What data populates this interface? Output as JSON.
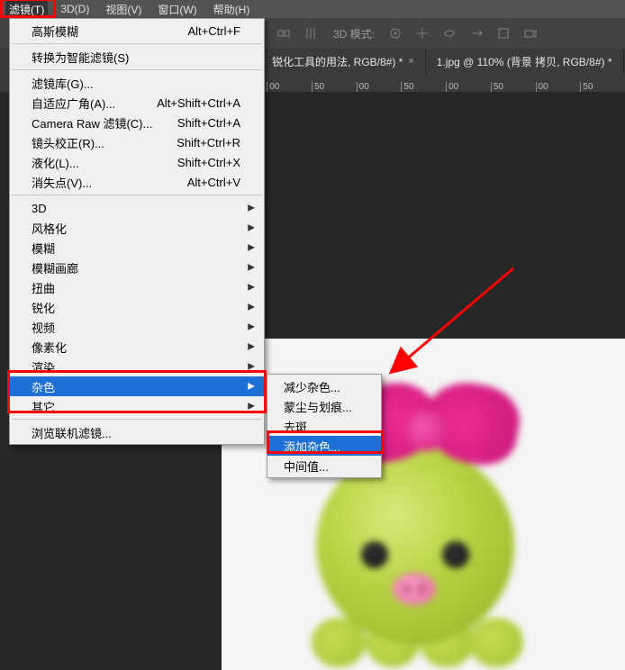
{
  "menubar": {
    "items": [
      {
        "label": "滤镜(T)",
        "active": true
      },
      {
        "label": "3D(D)"
      },
      {
        "label": "视图(V)"
      },
      {
        "label": "窗口(W)"
      },
      {
        "label": "帮助(H)"
      }
    ]
  },
  "toolbar": {
    "mode_label": "3D 模式:"
  },
  "tabs": [
    {
      "label": "锐化工具的用法, RGB/8#) *"
    },
    {
      "label": "1.jpg @ 110% (背景 拷贝, RGB/8#) *"
    }
  ],
  "ruler": [
    "00",
    "50",
    "00",
    "50",
    "00",
    "50",
    "00",
    "50"
  ],
  "filter_menu": {
    "s1": [
      {
        "label": "高斯模糊",
        "shortcut": "Alt+Ctrl+F"
      }
    ],
    "s2": [
      {
        "label": "转换为智能滤镜(S)"
      }
    ],
    "s3": [
      {
        "label": "滤镜库(G)..."
      },
      {
        "label": "自适应广角(A)...",
        "shortcut": "Alt+Shift+Ctrl+A"
      },
      {
        "label": "Camera Raw 滤镜(C)...",
        "shortcut": "Shift+Ctrl+A"
      },
      {
        "label": "镜头校正(R)...",
        "shortcut": "Shift+Ctrl+R"
      },
      {
        "label": "液化(L)...",
        "shortcut": "Shift+Ctrl+X"
      },
      {
        "label": "消失点(V)...",
        "shortcut": "Alt+Ctrl+V"
      }
    ],
    "s4": [
      {
        "label": "3D",
        "sub": true
      },
      {
        "label": "风格化",
        "sub": true
      },
      {
        "label": "模糊",
        "sub": true
      },
      {
        "label": "模糊画廊",
        "sub": true
      },
      {
        "label": "扭曲",
        "sub": true
      },
      {
        "label": "锐化",
        "sub": true
      },
      {
        "label": "视频",
        "sub": true
      },
      {
        "label": "像素化",
        "sub": true
      },
      {
        "label": "渲染",
        "sub": true
      },
      {
        "label": "杂色",
        "sub": true,
        "highlight": true
      },
      {
        "label": "其它",
        "sub": true
      }
    ],
    "s5": [
      {
        "label": "浏览联机滤镜..."
      }
    ]
  },
  "submenu": [
    {
      "label": "减少杂色..."
    },
    {
      "label": "蒙尘与划痕..."
    },
    {
      "label": "去斑"
    },
    {
      "label": "添加杂色...",
      "highlight": true
    },
    {
      "label": "中间值..."
    }
  ]
}
